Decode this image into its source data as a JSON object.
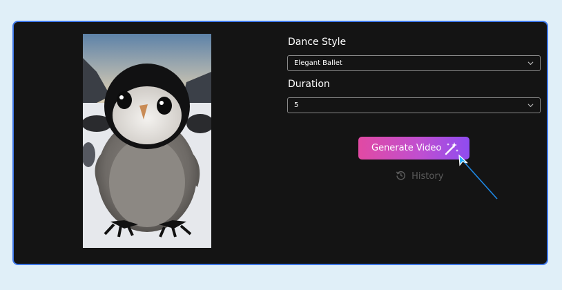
{
  "form": {
    "dance_style_label": "Dance Style",
    "dance_style_value": "Elegant Ballet",
    "duration_label": "Duration",
    "duration_value": "5"
  },
  "actions": {
    "generate_label": "Generate Video",
    "generate_icon": "magic-wand-icon",
    "history_label": "History",
    "history_icon": "history-icon"
  },
  "preview": {
    "subject": "baby-penguin-photo"
  },
  "colors": {
    "panel_bg": "#141414",
    "panel_border": "#3f78e8",
    "page_bg": "#e0eff8",
    "button_gradient_start": "#e14aa3",
    "button_gradient_end": "#8f4cf0",
    "muted_text": "#5b5b5b"
  }
}
